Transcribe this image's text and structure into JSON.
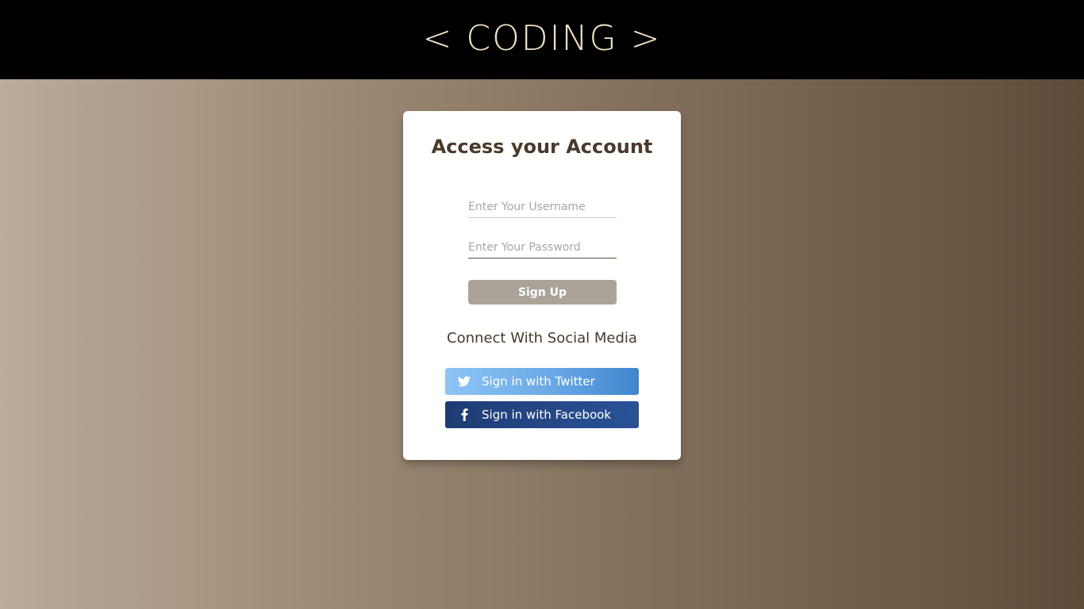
{
  "header": {
    "brand": "< CODING >"
  },
  "card": {
    "title": "Access your Account",
    "username_placeholder": "Enter Your Username",
    "password_placeholder": "Enter Your Password",
    "signup_label": "Sign Up",
    "social_heading": "Connect With Social Media",
    "twitter_label": "Sign in with Twitter",
    "facebook_label": "Sign in with Facebook",
    "twitter_icon": "twitter-bird-icon",
    "facebook_icon": "facebook-f-icon"
  },
  "colors": {
    "header_bg": "#000000",
    "brand_text": "#f1e3c8",
    "title_text": "#4a3a2a",
    "signup_bg": "#aca398",
    "twitter_start": "#8fc5f5",
    "twitter_end": "#3f86cf",
    "facebook_start": "#1e3c72",
    "facebook_end": "#2a5298"
  }
}
